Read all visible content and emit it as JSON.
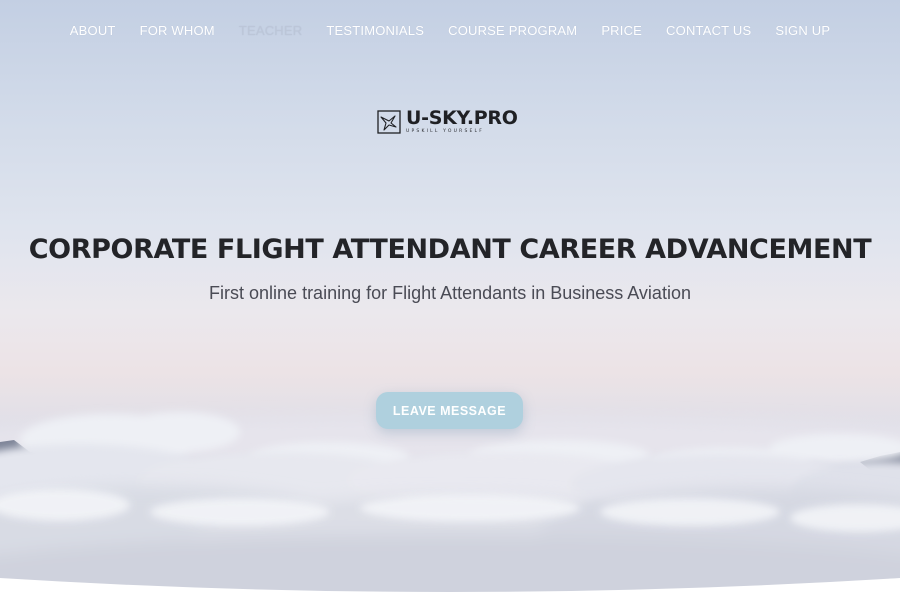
{
  "nav": {
    "items": [
      {
        "label": "ABOUT"
      },
      {
        "label": "FOR WHOM"
      },
      {
        "label": "TEACHER",
        "active": true
      },
      {
        "label": "TESTIMONIALS"
      },
      {
        "label": "COURSE PROGRAM"
      },
      {
        "label": "PRICE"
      },
      {
        "label": "CONTACT US"
      },
      {
        "label": "SIGN UP"
      }
    ]
  },
  "logo": {
    "name": "U-SKY.PRO",
    "tagline": "UPSKILL YOURSELF",
    "icon": "bird-in-frame-icon"
  },
  "hero": {
    "headline": "CORPORATE FLIGHT ATTENDANT CAREER ADVANCEMENT",
    "subheadline": "First online training for Flight Attendants in Business Aviation",
    "cta_label": "LEAVE MESSAGE",
    "background": "sky-above-clouds"
  },
  "colors": {
    "cta": "#afd0de",
    "nav_text": "#ffffff",
    "nav_active": "#bcc6d8",
    "headline": "#232428"
  }
}
